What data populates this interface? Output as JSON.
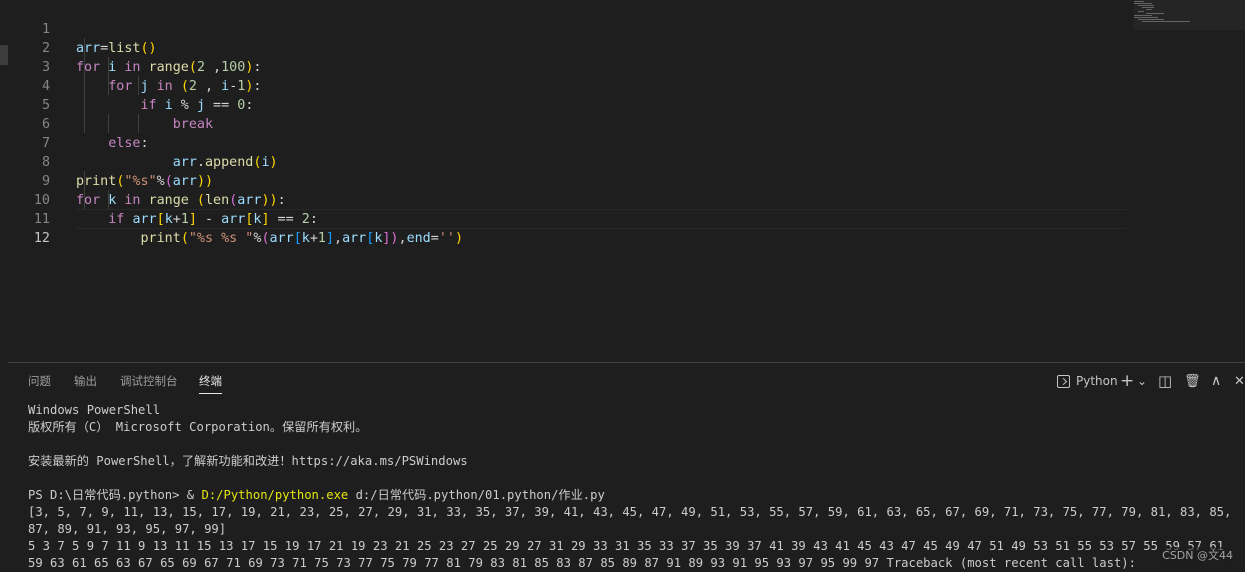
{
  "editor": {
    "lines": [
      {
        "n": "1"
      },
      {
        "n": "2"
      },
      {
        "n": "3"
      },
      {
        "n": "4"
      },
      {
        "n": "5"
      },
      {
        "n": "6"
      },
      {
        "n": "7"
      },
      {
        "n": "8"
      },
      {
        "n": "9"
      },
      {
        "n": "10"
      },
      {
        "n": "11"
      },
      {
        "n": "12"
      }
    ],
    "tokens": {
      "l1": [
        "arr",
        "=",
        "list",
        "()"
      ],
      "l2": [
        "for",
        "i",
        "in",
        "range",
        "(",
        "2",
        " ,",
        "100",
        ")",
        ":"
      ],
      "l3": [
        "for",
        "j",
        "in",
        "(",
        "2",
        " , ",
        "i",
        "-",
        "1",
        ")",
        ":"
      ],
      "l4": [
        "if",
        "i",
        " % ",
        "j",
        " == ",
        "0",
        ":"
      ],
      "l5": [
        "break"
      ],
      "l6": [
        "else",
        ":"
      ],
      "l7": [
        "arr",
        ".",
        "append",
        "(",
        "i",
        ")"
      ],
      "l8": [
        "print",
        "(",
        "\"%s\"",
        "%",
        "(",
        "arr",
        "))"
      ],
      "l9": [
        "for",
        "k",
        "in",
        "range",
        " (",
        "len",
        "(",
        "arr",
        "))",
        ":"
      ],
      "l10": [
        "if",
        "arr",
        "[",
        "k",
        "+",
        "1",
        "]",
        " - ",
        "arr",
        "[",
        "k",
        "]",
        " == ",
        "2",
        ":"
      ],
      "l11": [
        "print",
        "(",
        "\"%s %s \"",
        "%",
        "(",
        "arr",
        "[",
        "k",
        "+",
        "1",
        "]",
        ",",
        "arr",
        "[",
        "k",
        "])",
        ",",
        "end",
        "=",
        "''",
        ")"
      ]
    }
  },
  "panel": {
    "tabs": [
      {
        "label": "问题"
      },
      {
        "label": "输出"
      },
      {
        "label": "调试控制台"
      },
      {
        "label": "终端"
      }
    ],
    "profile_label": "Python",
    "add_label": "+",
    "dropdown_glyph": "⌄",
    "split_glyph": "◫",
    "trash_glyph": "🗑",
    "maximize_glyph": "∧",
    "close_glyph": "✕"
  },
  "terminal": {
    "lines": [
      "Windows PowerShell",
      "版权所有（C） Microsoft Corporation。保留所有权利。",
      "",
      "安装最新的 PowerShell，了解新功能和改进！https://aka.ms/PSWindows",
      "",
      "PS D:\\日常代码.python> & ",
      "[3, 5, 7, 9, 11, 13, 15, 17, 19, 21, 23, 25, 27, 29, 31, 33, 35, 37, 39, 41, 43, 45, 47, 49, 51, 53, 55, 57, 59, 61, 63, 65, 67, 69, 71, 73, 75, 77, 79, 81, 83, 85, 87, 89, 91, 93, 95, 97, 99]",
      "5 3 7 5 9 7 11 9 13 11 15 13 17 15 19 17 21 19 23 21 25 23 27 25 29 27 31 29 33 31 35 33 37 35 39 37 41 39 43 41 45 43 47 45 49 47 51 49 53 51 55 53 57 55 59 57 61 59 63 61 65 63 67 65 69 67 71 69 73 71 75 73 77 75 79 77 81 79 83 81 85 83 87 85 89 87 91 89 93 91 95 93 97 95 99 97 Traceback (most recent call last):"
    ],
    "cmd_exe": "D:/Python/python.exe",
    "cmd_arg": " d:/日常代码.python/01.python/作业.py"
  },
  "watermark": "CSDN @文44",
  "colors": {
    "background": "#1e1e1e",
    "keyword": "#c586c0",
    "function": "#dcdcaa",
    "variable": "#9cdcfe",
    "number": "#b5cea8",
    "string": "#ce9178",
    "terminal_exe": "#e5e510"
  }
}
